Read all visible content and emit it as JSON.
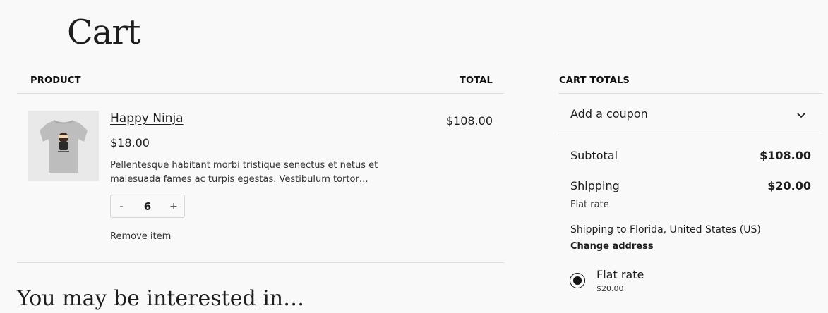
{
  "page": {
    "title": "Cart"
  },
  "table": {
    "col_product": "PRODUCT",
    "col_total": "TOTAL"
  },
  "item": {
    "name": "Happy Ninja",
    "price": "$18.00",
    "description": "Pellentesque habitant morbi tristique senectus et netus et malesuada fames ac turpis egestas. Vestibulum tortor…",
    "qty_decrement": "-",
    "qty_value": "6",
    "qty_increment": "+",
    "remove_label": "Remove item",
    "line_total": "$108.00",
    "image_icon": "tshirt-ninja-image"
  },
  "totals": {
    "heading": "CART TOTALS",
    "coupon_label": "Add a coupon",
    "subtotal_label": "Subtotal",
    "subtotal_value": "$108.00",
    "shipping_label": "Shipping",
    "shipping_value": "$20.00",
    "shipping_method": "Flat rate",
    "shipping_to": "Shipping to Florida, United States (US)",
    "change_address": "Change address",
    "option_label": "Flat rate",
    "option_price": "$20.00"
  },
  "below": {
    "heading_cutoff": "You may be interested in…"
  }
}
